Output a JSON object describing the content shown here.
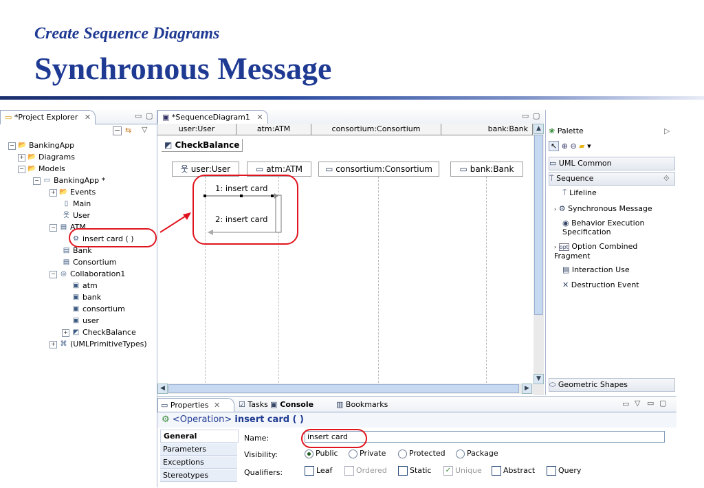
{
  "slide": {
    "subtitle": "Create Sequence Diagrams",
    "title": "Synchronous Message"
  },
  "explorer": {
    "tab_label": "*Project Explorer",
    "tree": [
      {
        "label": "BankingApp",
        "expander": "−",
        "icon": "📂"
      },
      {
        "label": "Diagrams",
        "expander": "+",
        "icon": "📂"
      },
      {
        "label": "Models",
        "expander": "−",
        "icon": "📂"
      },
      {
        "label": "BankingApp *",
        "expander": "−",
        "icon": "▭"
      },
      {
        "label": "Events",
        "expander": "+",
        "icon": "📂"
      },
      {
        "label": "Main",
        "expander": "",
        "icon": "▯"
      },
      {
        "label": "User",
        "expander": "",
        "icon": "웃"
      },
      {
        "label": "ATM",
        "expander": "−",
        "icon": "▤"
      },
      {
        "label": "insert card ( )",
        "expander": "",
        "icon": "⚙"
      },
      {
        "label": "Bank",
        "expander": "",
        "icon": "▤"
      },
      {
        "label": "Consortium",
        "expander": "",
        "icon": "▤"
      },
      {
        "label": "Collaboration1",
        "expander": "−",
        "icon": "◎"
      },
      {
        "label": "atm",
        "expander": "",
        "icon": "▣"
      },
      {
        "label": "bank",
        "expander": "",
        "icon": "▣"
      },
      {
        "label": "consortium",
        "expander": "",
        "icon": "▣"
      },
      {
        "label": "user",
        "expander": "",
        "icon": "▣"
      },
      {
        "label": "CheckBalance",
        "expander": "+",
        "icon": "◩"
      },
      {
        "label": "(UMLPrimitiveTypes)",
        "expander": "+",
        "icon": "⌘"
      }
    ]
  },
  "editor": {
    "tab_label": "*SequenceDiagram1",
    "headers": [
      "user:User",
      "atm:ATM",
      "consortium:Consortium",
      "bank:Bank"
    ],
    "frame_name": "CheckBalance",
    "lifelines": [
      "user:User",
      "atm:ATM",
      "consortium:Consortium",
      "bank:Bank"
    ],
    "messages": [
      "1: insert card",
      "2: insert card"
    ]
  },
  "palette": {
    "title": "Palette",
    "drawers": [
      "UML Common",
      "Sequence",
      "Geometric Shapes"
    ],
    "items": [
      "Lifeline",
      "Synchronous Message",
      "Behavior Execution Specification",
      "Option Combined Fragment",
      "Interaction Use",
      "Destruction Event"
    ]
  },
  "properties": {
    "tabs": [
      "Properties",
      "Tasks",
      "Console",
      "Bookmarks"
    ],
    "element_kind": "<Operation>",
    "element_name": "insert card ( )",
    "categories": [
      "General",
      "Parameters",
      "Exceptions",
      "Stereotypes"
    ],
    "name_label": "Name:",
    "name_value": "insert card",
    "visibility_label": "Visibility:",
    "visibility_options": [
      "Public",
      "Private",
      "Protected",
      "Package"
    ],
    "qualifiers_label": "Qualifiers:",
    "qualifiers": [
      "Leaf",
      "Ordered",
      "Static",
      "Unique",
      "Abstract",
      "Query"
    ]
  },
  "colors": {
    "accent": "#1f3a93",
    "highlight": "#e0141e"
  }
}
